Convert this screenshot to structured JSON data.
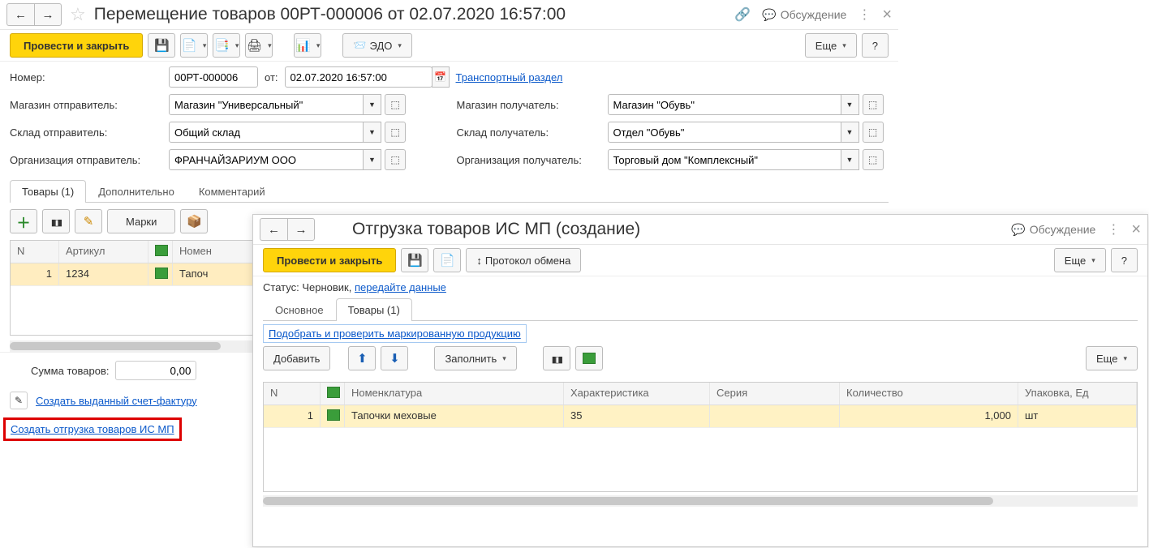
{
  "win1": {
    "title": "Перемещение товаров 00РТ-000006 от 02.07.2020 16:57:00",
    "discuss": "Обсуждение",
    "toolbar": {
      "post_close": "Провести и закрыть",
      "edo": "ЭДО",
      "more": "Еще",
      "help": "?"
    },
    "form": {
      "number_lbl": "Номер:",
      "number_val": "00РТ-000006",
      "from_lbl": "от:",
      "date_val": "02.07.2020 16:57:00",
      "transport_link": "Транспортный раздел",
      "store_send_lbl": "Магазин отправитель:",
      "store_send_val": "Магазин \"Универсальный\"",
      "store_recv_lbl": "Магазин получатель:",
      "store_recv_val": "Магазин \"Обувь\"",
      "wh_send_lbl": "Склад отправитель:",
      "wh_send_val": "Общий склад",
      "wh_recv_lbl": "Склад получатель:",
      "wh_recv_val": "Отдел \"Обувь\"",
      "org_send_lbl": "Организация отправитель:",
      "org_send_val": "ФРАНЧАЙЗАРИУМ ООО",
      "org_recv_lbl": "Организация получатель:",
      "org_recv_val": "Торговый дом \"Комплексный\""
    },
    "tabs": {
      "t1": "Товары (1)",
      "t2": "Дополнительно",
      "t3": "Комментарий"
    },
    "tab_toolbar": {
      "marks": "Марки"
    },
    "grid": {
      "cols": {
        "n": "N",
        "art": "Артикул",
        "nom": "Номен"
      },
      "row": {
        "n": "1",
        "art": "1234",
        "nom": "Тапоч"
      }
    },
    "footer": {
      "sum_lbl": "Сумма товаров:",
      "sum_val": "0,00",
      "invoice_link": "Создать выданный счет-фактуру",
      "ship_link": "Создать отгрузка товаров ИС МП"
    }
  },
  "win2": {
    "title": "Отгрузка товаров ИС МП (создание)",
    "discuss": "Обсуждение",
    "toolbar": {
      "post_close": "Провести и закрыть",
      "protocol": "Протокол обмена",
      "more": "Еще",
      "help": "?"
    },
    "status": {
      "lbl": "Статус:",
      "val": "Черновик,",
      "link": "передайте данные"
    },
    "tabs": {
      "t1": "Основное",
      "t2": "Товары (1)"
    },
    "sublink": "Подобрать и проверить маркированную продукцию",
    "tab_toolbar": {
      "add": "Добавить",
      "fill": "Заполнить",
      "more": "Еще"
    },
    "grid": {
      "cols": {
        "n": "N",
        "nom": "Номенклатура",
        "char": "Характеристика",
        "ser": "Серия",
        "qty": "Количество",
        "pack": "Упаковка, Ед"
      },
      "row": {
        "n": "1",
        "nom": "Тапочки меховые",
        "char": "35",
        "ser": "",
        "qty": "1,000",
        "pack": "шт"
      }
    }
  }
}
